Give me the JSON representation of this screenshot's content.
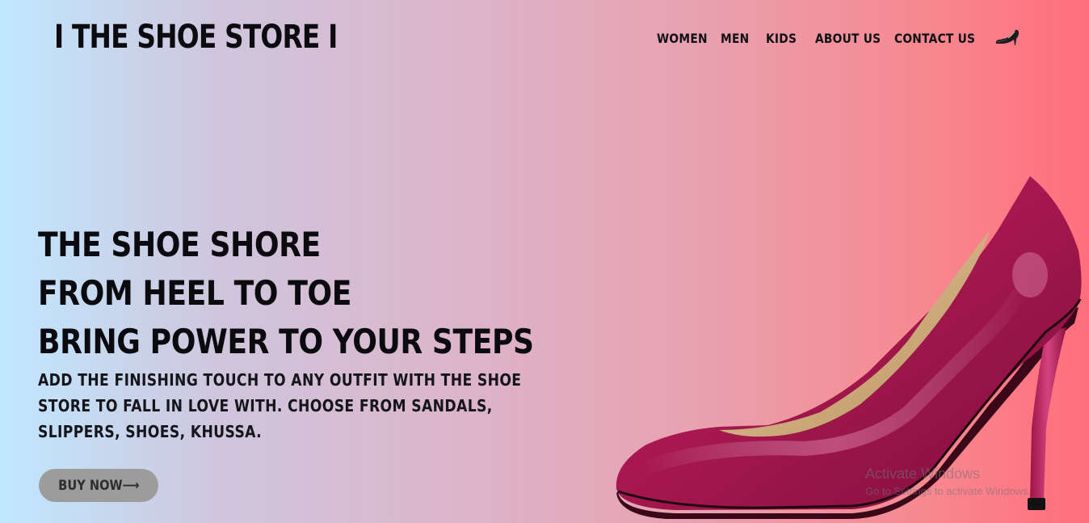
{
  "header": {
    "brand": "I THE SHOE STORE I",
    "nav": {
      "women": "WOMEN",
      "men": "MEN",
      "kids": "KIDS",
      "about": "ABOUT US",
      "contact": "CONTACT US"
    },
    "cart_icon": "high-heel-icon"
  },
  "hero": {
    "title_lines": [
      "THE SHOE SHORE",
      "FROM HEEL TO TOE",
      "BRING POWER TO YOUR STEPS"
    ],
    "description": "ADD THE FINISHING TOUCH TO ANY OUTFIT WITH THE SHOE STORE TO FALL IN LOVE WITH. CHOOSE FROM SANDALS, SLIPPERS, SHOES, KHUSSA.",
    "button_label": "BUY NOW⟶",
    "image": "high-heel-shoe"
  },
  "watermark": {
    "title": "Activate Windows",
    "subtitle": "Go to Settings to activate Windows."
  },
  "colors": {
    "gradient_start": "#c0e8ff",
    "gradient_end": "#ff6e7c",
    "button_bg": "#9c9c9c",
    "shoe": "#a8184f"
  }
}
